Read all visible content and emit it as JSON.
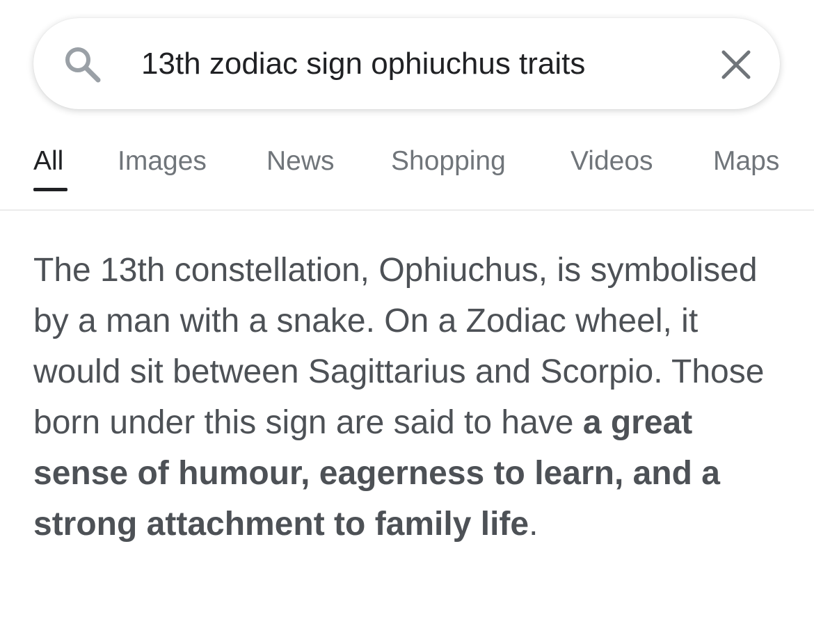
{
  "search": {
    "query": "13th zodiac sign ophiuchus traits",
    "search_icon": "search-icon",
    "clear_icon": "close-icon"
  },
  "tabs": [
    {
      "label": "All",
      "active": true
    },
    {
      "label": "Images",
      "active": false
    },
    {
      "label": "News",
      "active": false
    },
    {
      "label": "Shopping",
      "active": false
    },
    {
      "label": "Videos",
      "active": false
    },
    {
      "label": "Maps",
      "active": false
    }
  ],
  "snippet": {
    "text_before": "The 13th constellation, Ophiuchus, is symbolised by a man with a snake. On a Zodiac wheel, it would sit between Sagittarius and Scorpio. Those born under this sign are said to have ",
    "text_bold": "a great sense of humour, eagerness to learn, and a strong attachment to family life",
    "text_after": "."
  },
  "colors": {
    "text_primary": "#202124",
    "text_secondary": "#70757a",
    "snippet_text": "#4d5156",
    "icon": "#70757a"
  }
}
